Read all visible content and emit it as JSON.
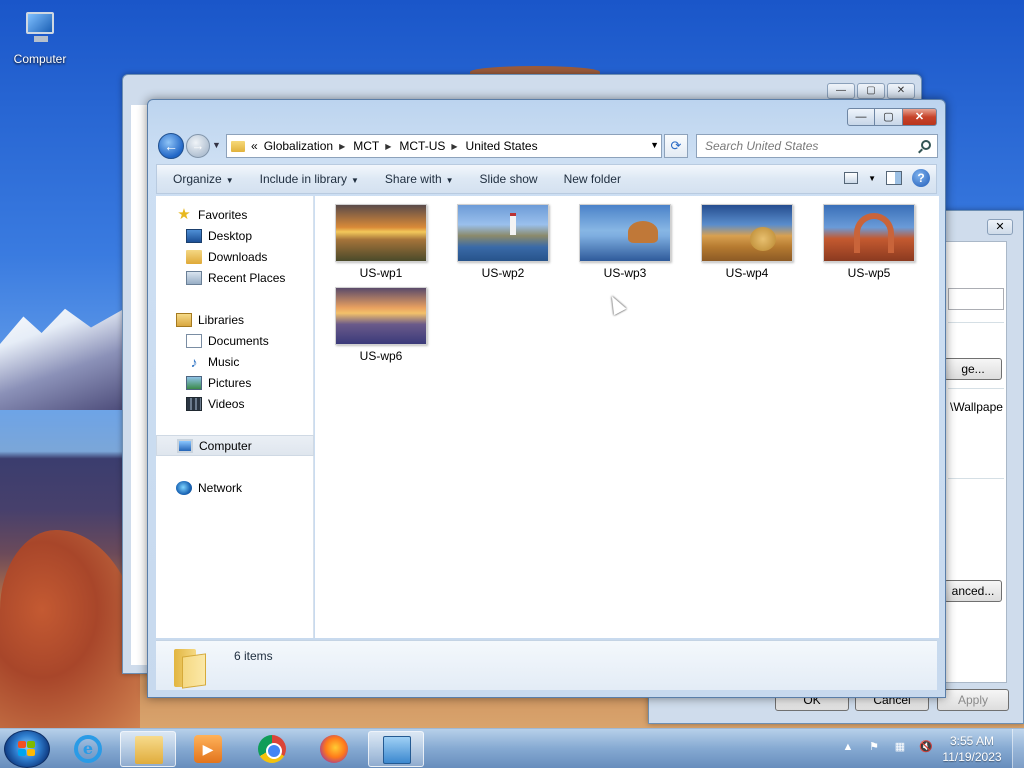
{
  "desktop": {
    "icons": [
      {
        "label": "Computer",
        "icon": "computer-icon"
      }
    ]
  },
  "background_dialog": {
    "field_suffix": "\\Wallpape",
    "browse_label": "ge...",
    "advanced_label": "anced...",
    "ok_label": "OK",
    "cancel_label": "Cancel",
    "apply_label": "Apply"
  },
  "explorer": {
    "window_controls": {
      "minimize": "—",
      "maximize": "▢",
      "close": "✕"
    },
    "address": {
      "overflow": "«",
      "breadcrumbs": [
        "Globalization",
        "MCT",
        "MCT-US",
        "United States"
      ]
    },
    "search": {
      "placeholder": "Search United States"
    },
    "toolbar": {
      "organize": "Organize",
      "include_in_library": "Include in library",
      "share_with": "Share with",
      "slide_show": "Slide show",
      "new_folder": "New folder"
    },
    "nav": {
      "favorites": {
        "label": "Favorites",
        "items": [
          "Desktop",
          "Downloads",
          "Recent Places"
        ]
      },
      "libraries": {
        "label": "Libraries",
        "items": [
          "Documents",
          "Music",
          "Pictures",
          "Videos"
        ]
      },
      "computer": "Computer",
      "network": "Network"
    },
    "files": [
      {
        "name": "US-wp1"
      },
      {
        "name": "US-wp2"
      },
      {
        "name": "US-wp3"
      },
      {
        "name": "US-wp4"
      },
      {
        "name": "US-wp5"
      },
      {
        "name": "US-wp6"
      }
    ],
    "details": {
      "item_count": "6 items"
    }
  },
  "taskbar": {
    "apps": [
      "internet-explorer-icon",
      "windows-explorer-icon",
      "media-center-icon",
      "chrome-icon",
      "firefox-icon",
      "control-panel-icon"
    ],
    "tray": {
      "show_hidden": "▲"
    },
    "clock": {
      "time": "3:55 AM",
      "date": "11/19/2023"
    }
  }
}
